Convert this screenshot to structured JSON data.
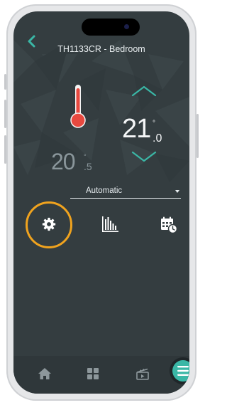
{
  "header": {
    "title": "TH1133CR - Bedroom"
  },
  "temperature": {
    "setpoint_whole": "21",
    "setpoint_decimal": ".0",
    "current_whole": "20",
    "current_decimal": ".5",
    "degree_symbol": "°"
  },
  "mode": {
    "selected": "Automatic"
  },
  "colors": {
    "accent": "#3ab7a6",
    "highlight_ring": "#f0a31e",
    "background": "#343d40",
    "thermometer_red": "#e8493f"
  },
  "icons": {
    "back": "back-arrow-icon",
    "thermometer": "thermometer-icon",
    "increase": "chevron-up-icon",
    "decrease": "chevron-down-icon",
    "settings": "gear-icon",
    "stats": "bar-chart-icon",
    "schedule": "calendar-clock-icon",
    "tab_home": "home-icon",
    "tab_grid": "grid-icon",
    "tab_scenes": "clapperboard-icon",
    "menu": "menu-icon"
  }
}
